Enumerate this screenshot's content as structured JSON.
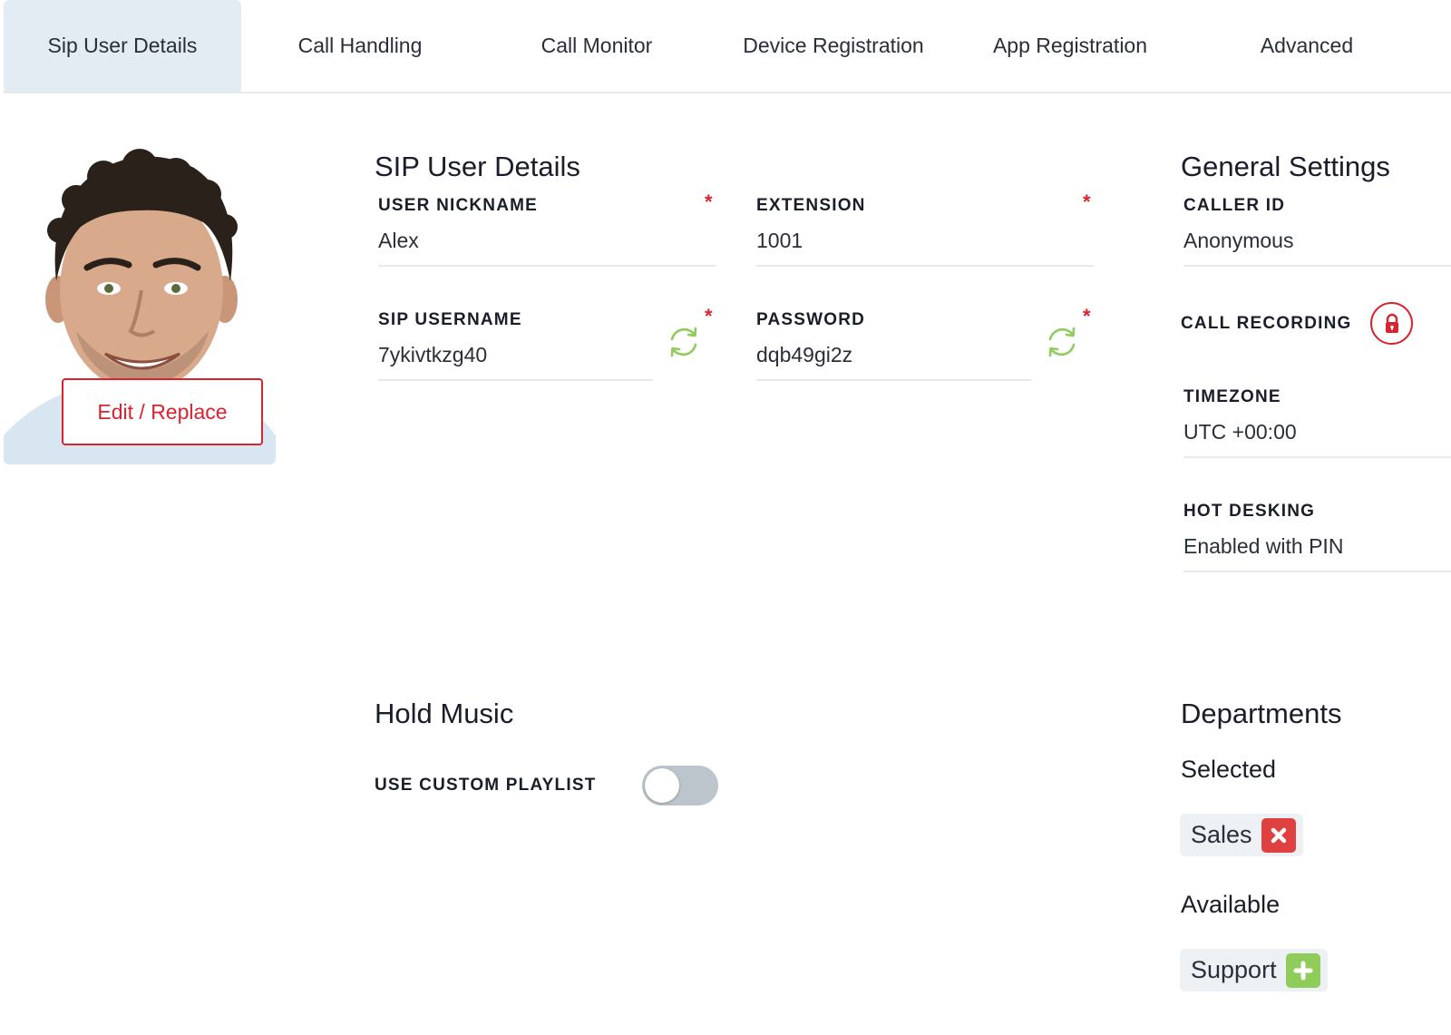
{
  "tabs": [
    {
      "label": "Sip User Details",
      "active": true
    },
    {
      "label": "Call Handling",
      "active": false
    },
    {
      "label": "Call Monitor",
      "active": false
    },
    {
      "label": "Device Registration",
      "active": false
    },
    {
      "label": "App Registration",
      "active": false
    },
    {
      "label": "Advanced",
      "active": false
    }
  ],
  "avatar": {
    "edit_label": "Edit / Replace"
  },
  "sip_user_details": {
    "heading": "SIP User Details",
    "user_nickname": {
      "label": "USER NICKNAME",
      "value": "Alex",
      "required_mark": "*"
    },
    "extension": {
      "label": "EXTENSION",
      "value": "1001",
      "required_mark": "*"
    },
    "sip_username": {
      "label": "SIP USERNAME",
      "value": "7ykivtkzg40",
      "required_mark": "*",
      "icon": "refresh-icon"
    },
    "password": {
      "label": "PASSWORD",
      "value": "dqb49gi2z",
      "required_mark": "*",
      "icon": "refresh-icon"
    }
  },
  "general_settings": {
    "heading": "General Settings",
    "caller_id": {
      "label": "CALLER ID",
      "value": "Anonymous"
    },
    "call_recording": {
      "label": "CALL RECORDING",
      "icon": "lock-icon",
      "locked": true
    },
    "timezone": {
      "label": "TIMEZONE",
      "value": "UTC +00:00"
    },
    "hot_desking": {
      "label": "HOT DESKING",
      "value": "Enabled with PIN"
    }
  },
  "hold_music": {
    "heading": "Hold Music",
    "use_custom_playlist": {
      "label": "USE CUSTOM PLAYLIST",
      "enabled": false
    }
  },
  "departments": {
    "heading": "Departments",
    "selected_label": "Selected",
    "selected": [
      {
        "name": "Sales",
        "icon": "remove-icon"
      }
    ],
    "available_label": "Available",
    "available": [
      {
        "name": "Support",
        "icon": "add-icon"
      }
    ]
  },
  "colors": {
    "accent_red": "#d9232f",
    "refresh_green": "#8fcc5a",
    "active_tab_bg": "#e3ecf2",
    "toggle_off": "#bcc5cc"
  }
}
